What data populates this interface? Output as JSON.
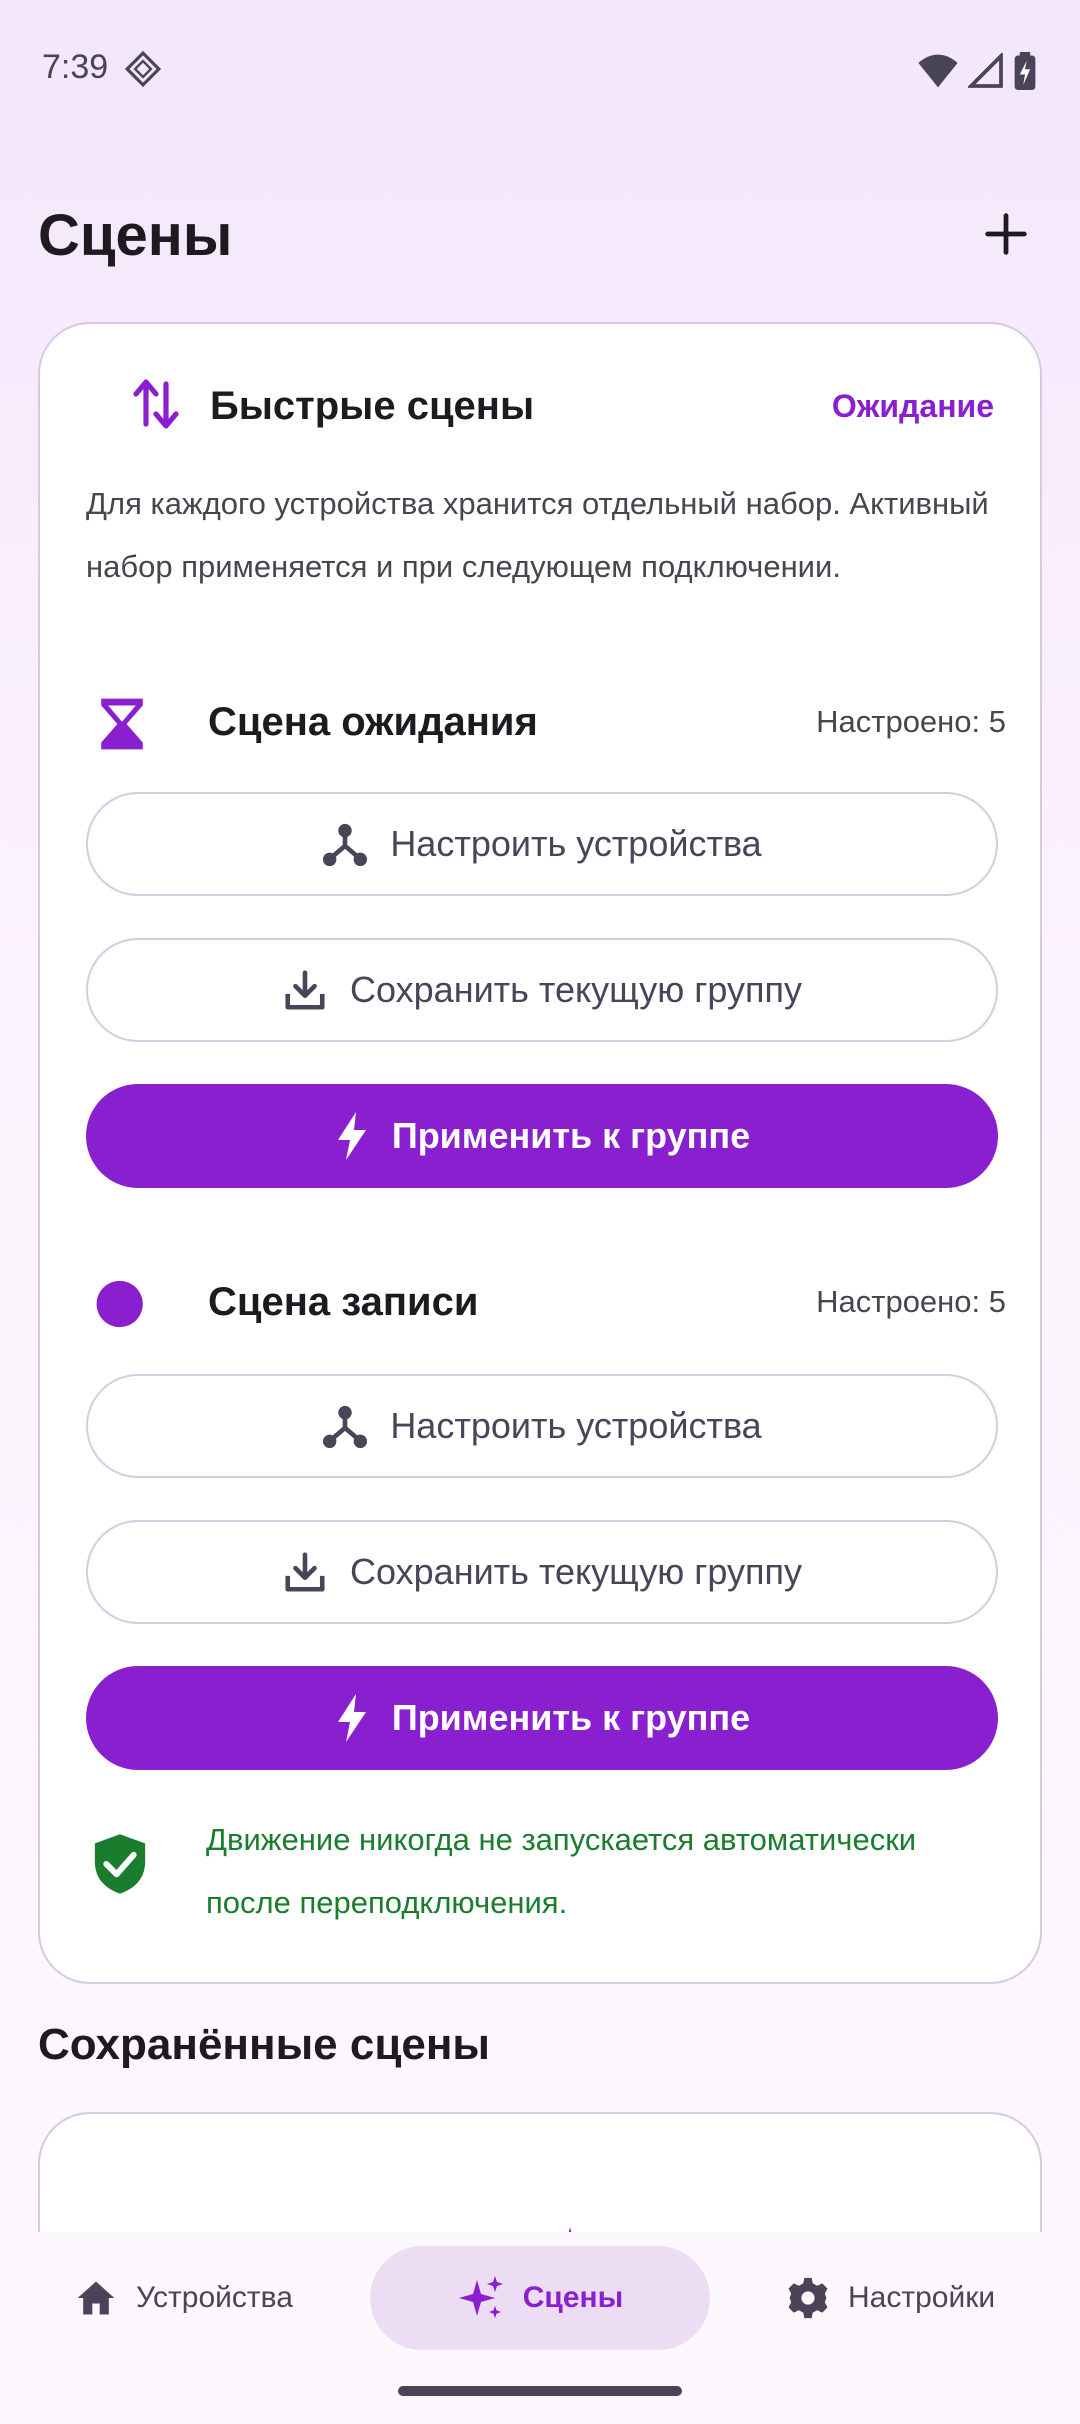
{
  "status_bar": {
    "time": "7:39"
  },
  "header": {
    "title": "Сцены",
    "add_icon": "plus-icon"
  },
  "quick_scenes": {
    "title": "Быстрые сцены",
    "status": "Ожидание",
    "description": "Для каждого устройства хранится отдельный набор. Активный набор применяется и при следующем подключении.",
    "scenes": [
      {
        "title": "Сцена ожидания",
        "icon": "hourglass-icon",
        "count_text": "Настроено: 5",
        "configure_label": "Настроить устройства",
        "save_label": "Сохранить текущую группу",
        "apply_label": "Применить к группе"
      },
      {
        "title": "Сцена записи",
        "icon": "record-dot-icon",
        "count_text": "Настроено: 5",
        "configure_label": "Настроить устройства",
        "save_label": "Сохранить текущую группу",
        "apply_label": "Применить к группе"
      }
    ],
    "note": "Движение никогда не запускается автоматически после переподключения."
  },
  "saved_scenes": {
    "title": "Сохранённые сцены"
  },
  "bottom_nav": {
    "items": [
      {
        "label": "Устройства",
        "icon": "home-icon"
      },
      {
        "label": "Сцены",
        "icon": "sparkle-icon",
        "active": true
      },
      {
        "label": "Настройки",
        "icon": "gear-icon"
      }
    ]
  },
  "colors": {
    "accent": "#8a1fcf",
    "success": "#1a7d2e",
    "surface": "#ffffff"
  }
}
